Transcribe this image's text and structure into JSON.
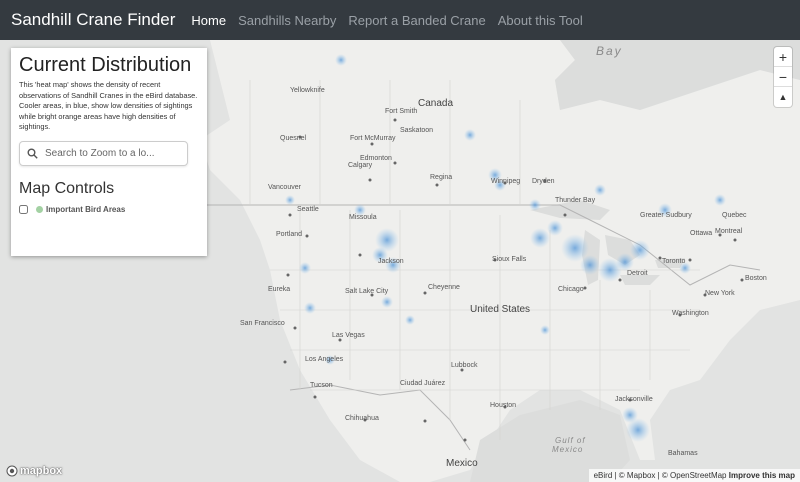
{
  "navbar": {
    "brand": "Sandhill Crane Finder",
    "links": [
      "Home",
      "Sandhills Nearby",
      "Report a Banded Crane",
      "About this Tool"
    ]
  },
  "panel": {
    "title": "Current Distribution",
    "description": "This 'heat map' shows the density of recent observations of Sandhill Cranes in the eBird database. Cooler areas, in blue, show low densities of sightings while bright orange areas have high densities of sightings.",
    "search_placeholder": "Search to Zoom to a lo...",
    "controls_title": "Map Controls",
    "control_label": "Important Bird Areas"
  },
  "zoom": {
    "in": "+",
    "out": "−",
    "compass": "▲"
  },
  "map": {
    "labels": {
      "bay": "Bay",
      "canada": "Canada",
      "united_states": "United States",
      "mexico": "Mexico",
      "gulf": "Gulf of",
      "mexico_gulf": "Mexico",
      "bahamas": "Bahamas",
      "fort_smith": "Fort Smith",
      "yellowknife": "Yellowknife",
      "fort_mcmurray": "Fort McMurray",
      "saskatoon": "Saskatoon",
      "edmonton": "Edmonton",
      "calgary": "Calgary",
      "regina": "Regina",
      "winnipeg": "Winnipeg",
      "dryden": "Dryden",
      "quesnel": "Quesnel",
      "vancouver": "Vancouver",
      "seattle": "Seattle",
      "portland": "Portland",
      "missoula": "Missoula",
      "eureka": "Eureka",
      "san_francisco": "San Francisco",
      "los_angeles": "Los Angeles",
      "las_vegas": "Las Vegas",
      "salt_lake_city": "Salt Lake City",
      "jackson": "Jackson",
      "cheyenne": "Cheyenne",
      "sioux_falls": "Sioux Falls",
      "thunder_bay": "Thunder Bay",
      "chicago": "Chicago",
      "detroit": "Detroit",
      "toronto": "Toronto",
      "ottawa": "Ottawa",
      "montreal": "Montreal",
      "quebec": "Quebec",
      "greater_sudbury": "Greater Sudbury",
      "boston": "Boston",
      "new_york": "New York",
      "washington": "Washington",
      "lubbock": "Lubbock",
      "ciudad_juarez": "Ciudad Juárez",
      "houston": "Houston",
      "jacksonville": "Jacksonville",
      "chihuahua": "Chihuahua",
      "tucson": "Tucson"
    }
  },
  "attribution": {
    "text": "eBird | © Mapbox | © OpenStreetMap",
    "improve": "Improve this map"
  },
  "mapbox_logo": "mapbox"
}
